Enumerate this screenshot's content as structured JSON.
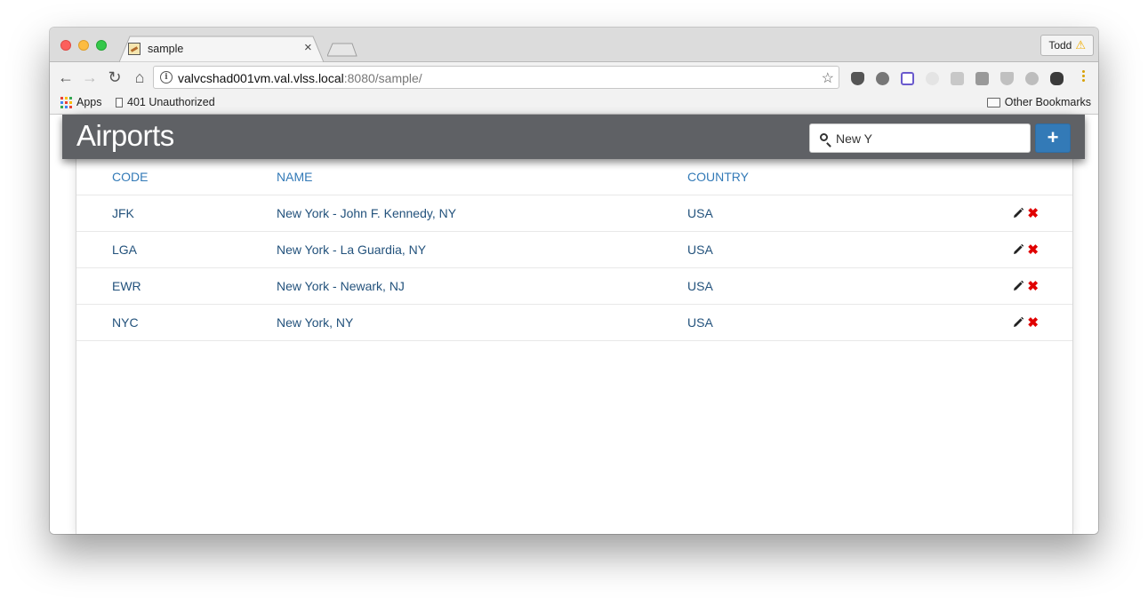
{
  "browser": {
    "tab": {
      "title": "sample"
    },
    "profile": {
      "name": "Todd"
    },
    "url": {
      "host": "valvcshad001vm.val.vlss.local",
      "rest": ":8080/sample/"
    },
    "bookmarks": {
      "apps": "Apps",
      "item1": "401 Unauthorized",
      "other": "Other Bookmarks"
    }
  },
  "app": {
    "title": "Airports",
    "search": {
      "value": "New Y"
    },
    "add_label": "+",
    "columns": [
      "CODE",
      "NAME",
      "COUNTRY"
    ],
    "rows": [
      {
        "code": "JFK",
        "name": "New York - John F. Kennedy, NY",
        "country": "USA"
      },
      {
        "code": "LGA",
        "name": "New York - La Guardia, NY",
        "country": "USA"
      },
      {
        "code": "EWR",
        "name": "New York - Newark, NJ",
        "country": "USA"
      },
      {
        "code": "NYC",
        "name": "New York, NY",
        "country": "USA"
      }
    ],
    "colors": {
      "header_bg": "#5f6165",
      "link": "#337ab7",
      "primary": "#337ab7",
      "delete": "#e00000"
    }
  }
}
